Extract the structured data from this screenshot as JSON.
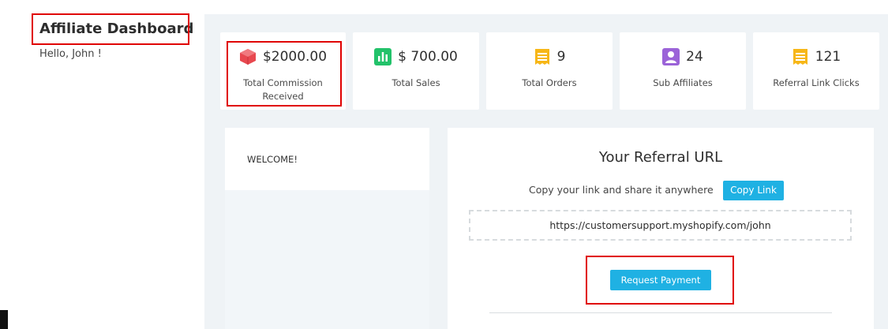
{
  "header": {
    "title": "Affiliate Dashboard",
    "greeting": "Hello, John !"
  },
  "stats": [
    {
      "icon": "cube-icon",
      "value": "$2000.00",
      "label": "Total Commission Received",
      "color": "#e8484f"
    },
    {
      "icon": "bar-chart-icon",
      "value": "$ 700.00",
      "label": "Total Sales",
      "color": "#22c26a"
    },
    {
      "icon": "receipt-icon",
      "value": "9",
      "label": "Total Orders",
      "color": "#f7b718"
    },
    {
      "icon": "user-icon",
      "value": "24",
      "label": "Sub Affiliates",
      "color": "#9b63d8"
    },
    {
      "icon": "receipt-icon",
      "value": "121",
      "label": "Referral Link Clicks",
      "color": "#f7b718"
    }
  ],
  "welcome": {
    "text": "WELCOME!"
  },
  "referral": {
    "title": "Your Referral URL",
    "instruction": "Copy your link and share it anywhere",
    "copy_label": "Copy Link",
    "url": "https://customersupport.myshopify.com/john",
    "request_label": "Request Payment"
  },
  "colors": {
    "accent": "#1fb1e3",
    "annotation": "#e00000"
  }
}
